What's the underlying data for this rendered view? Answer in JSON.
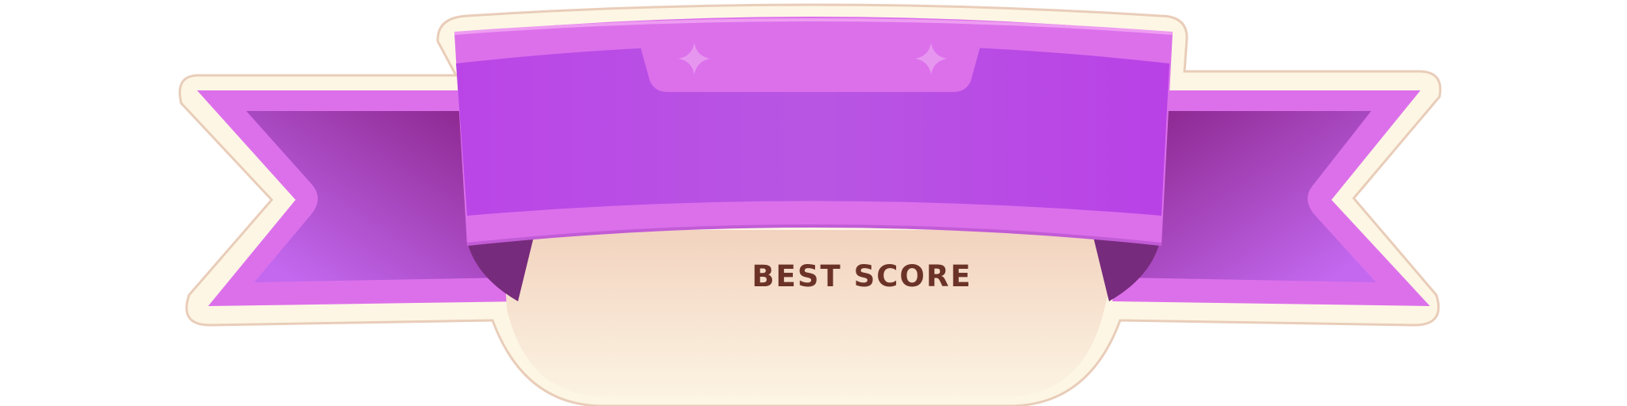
{
  "banner": {
    "label": "BEST SCORE",
    "icons": [
      "sparkle-icon",
      "sparkle-icon"
    ]
  },
  "colors": {
    "ribbon_front": "#b94ae6",
    "ribbon_highlight": "#dc70eb",
    "ribbon_tail": "#a33ad0",
    "ribbon_fold": "#772b7c",
    "outline_cream": "#fdf6e4",
    "outline_stroke": "#e9cdb9",
    "panel_top": "#f2d3bf",
    "panel_bottom": "#fcf3e2",
    "label_text": "#6b3328"
  }
}
